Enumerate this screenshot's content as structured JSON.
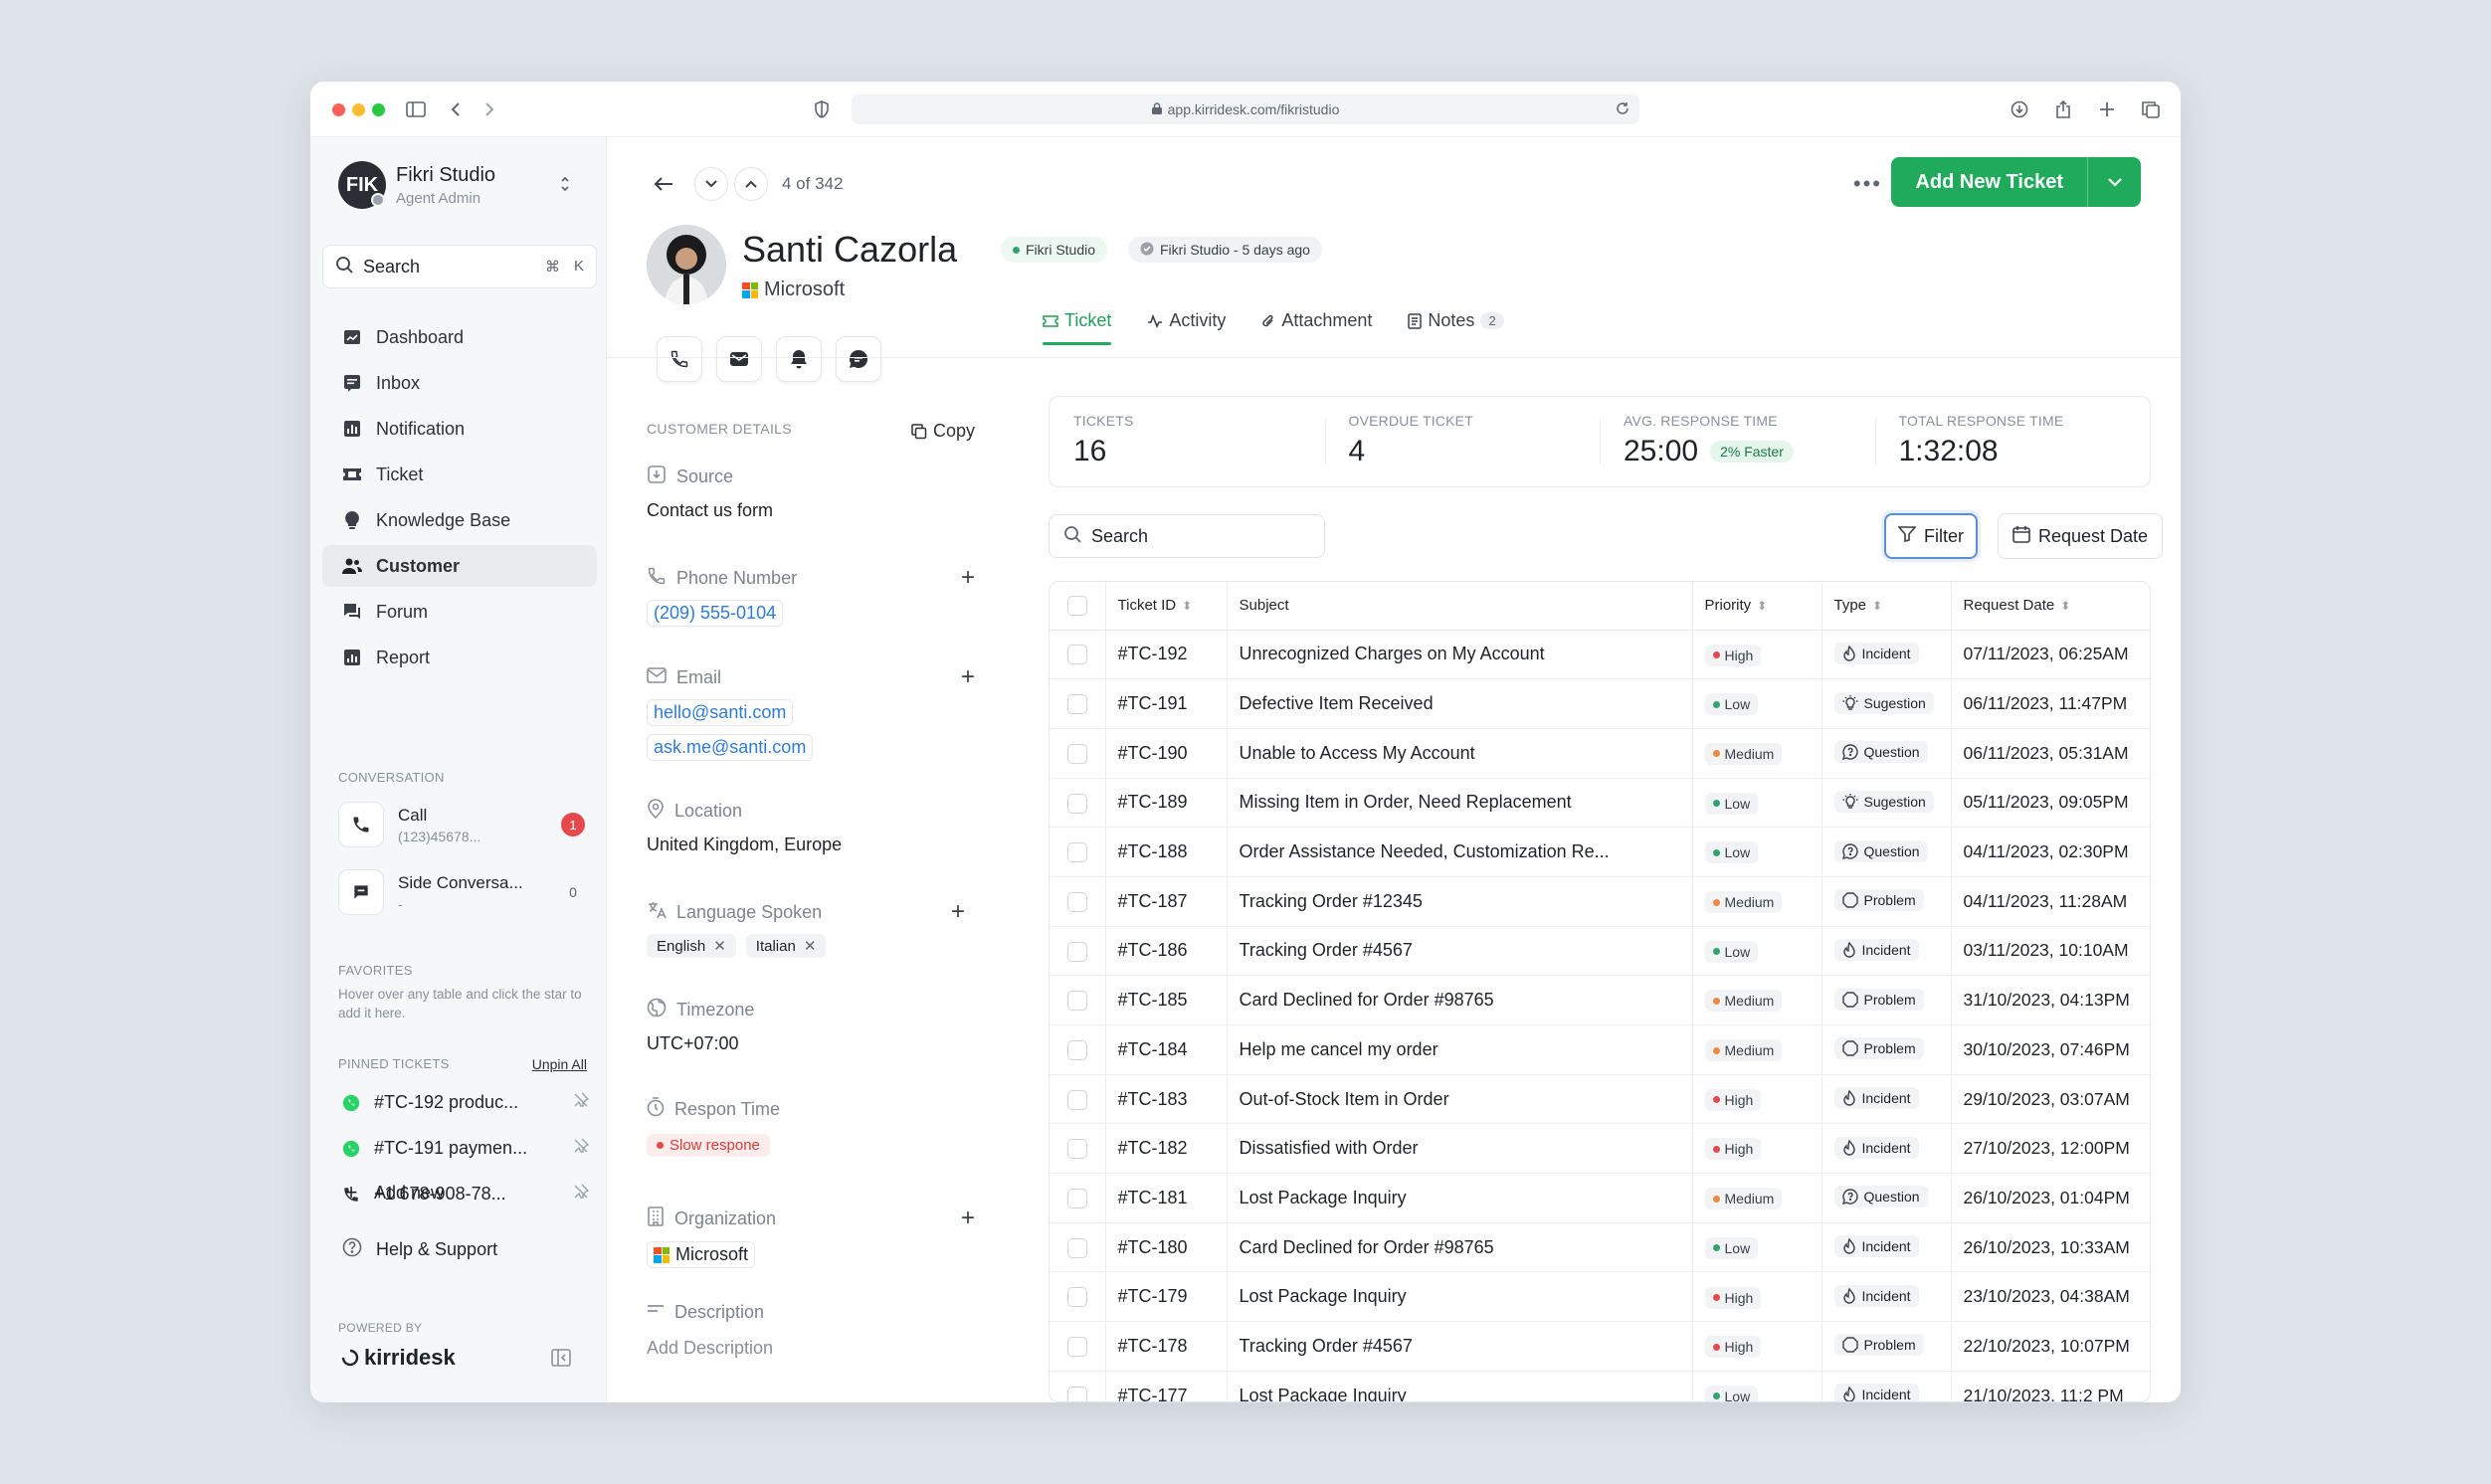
{
  "browser": {
    "url": "app.kirridesk.com/fikristudio"
  },
  "sidebar": {
    "org_initials": "FIK",
    "org_name": "Fikri Studio",
    "org_role": "Agent Admin",
    "search_label": "Search",
    "search_kbd_1": "⌘",
    "search_kbd_2": "K",
    "nav": [
      {
        "label": "Dashboard",
        "icon": "dashboard-icon"
      },
      {
        "label": "Inbox",
        "icon": "inbox-icon"
      },
      {
        "label": "Notification",
        "icon": "notification-icon"
      },
      {
        "label": "Ticket",
        "icon": "ticket-icon"
      },
      {
        "label": "Knowledge Base",
        "icon": "knowledge-icon"
      },
      {
        "label": "Customer",
        "icon": "customer-icon",
        "active": true
      },
      {
        "label": "Forum",
        "icon": "forum-icon"
      },
      {
        "label": "Report",
        "icon": "report-icon"
      }
    ],
    "conversation_title": "CONVERSATION",
    "conversations": [
      {
        "title": "Call",
        "sub": "(123)45678...",
        "count": "1"
      },
      {
        "title": "Side Conversa...",
        "sub": "-",
        "count": "0"
      }
    ],
    "favorites_title": "FAVORITES",
    "favorites_hint": "Hover over any table and click the star to add it here.",
    "pinned_title": "PINNED TICKETS",
    "unpin_all": "Unpin All",
    "pinned": [
      {
        "label": "#TC-192 produc...",
        "icon": "whatsapp-icon"
      },
      {
        "label": "#TC-191 paymen...",
        "icon": "whatsapp-icon"
      },
      {
        "label": "+1 678-908-78...",
        "icon": "phone-icon"
      }
    ],
    "add_new": "Add new",
    "help": "Help & Support",
    "powered_by": "POWERED BY",
    "brand": "kirridesk"
  },
  "header": {
    "pager": "4 of 342",
    "add_ticket": "Add New Ticket"
  },
  "customer": {
    "name": "Santi Cazorla",
    "status_chip": "Fikri Studio",
    "meta_chip": "Fikri Studio - 5 days ago",
    "company": "Microsoft"
  },
  "tabs": [
    {
      "label": "Ticket",
      "active": true
    },
    {
      "label": "Activity"
    },
    {
      "label": "Attachment"
    },
    {
      "label": "Notes",
      "count": "2"
    }
  ],
  "details": {
    "title": "CUSTOMER DETAILS",
    "copy": "Copy",
    "source_label": "Source",
    "source_value": "Contact us form",
    "phone_label": "Phone Number",
    "phone_value": "(209) 555-0104",
    "email_label": "Email",
    "emails": [
      "hello@santi.com",
      "ask.me@santi.com"
    ],
    "location_label": "Location",
    "location_value": "United Kingdom, Europe",
    "language_label": "Language Spoken",
    "languages": [
      "English",
      "Italian"
    ],
    "timezone_label": "Timezone",
    "timezone_value": "UTC+07:00",
    "response_label": "Respon Time",
    "response_value": "Slow respone",
    "organization_label": "Organization",
    "organization_value": "Microsoft",
    "description_label": "Description",
    "description_placeholder": "Add Description"
  },
  "stats": [
    {
      "label": "TICKETS",
      "value": "16"
    },
    {
      "label": "OVERDUE TICKET",
      "value": "4"
    },
    {
      "label": "AVG. RESPONSE TIME",
      "value": "25:00",
      "badge": "2% Faster"
    },
    {
      "label": "TOTAL RESPONSE TIME",
      "value": "1:32:08"
    }
  ],
  "table": {
    "search_placeholder": "Search",
    "filter": "Filter",
    "request_date": "Request Date",
    "columns": [
      "Ticket ID",
      "Subject",
      "Priority",
      "Type",
      "Request Date"
    ],
    "rows": [
      {
        "id": "#TC-192",
        "subject": "Unrecognized Charges on My Account",
        "priority": "High",
        "type": "Incident",
        "date": "07/11/2023, 06:25AM"
      },
      {
        "id": "#TC-191",
        "subject": "Defective Item Received",
        "priority": "Low",
        "type": "Sugestion",
        "date": "06/11/2023, 11:47PM"
      },
      {
        "id": "#TC-190",
        "subject": "Unable to Access My Account",
        "priority": "Medium",
        "type": "Question",
        "date": "06/11/2023, 05:31AM"
      },
      {
        "id": "#TC-189",
        "subject": "Missing Item in Order, Need Replacement",
        "priority": "Low",
        "type": "Sugestion",
        "date": "05/11/2023, 09:05PM"
      },
      {
        "id": "#TC-188",
        "subject": "Order Assistance Needed, Customization Re...",
        "priority": "Low",
        "type": "Question",
        "date": "04/11/2023, 02:30PM"
      },
      {
        "id": "#TC-187",
        "subject": "Tracking Order #12345",
        "priority": "Medium",
        "type": "Problem",
        "date": "04/11/2023, 11:28AM"
      },
      {
        "id": "#TC-186",
        "subject": "Tracking Order #4567",
        "priority": "Low",
        "type": "Incident",
        "date": "03/11/2023, 10:10AM"
      },
      {
        "id": "#TC-185",
        "subject": "Card Declined for Order #98765",
        "priority": "Medium",
        "type": "Problem",
        "date": "31/10/2023, 04:13PM"
      },
      {
        "id": "#TC-184",
        "subject": "Help me cancel my order",
        "priority": "Medium",
        "type": "Problem",
        "date": "30/10/2023, 07:46PM"
      },
      {
        "id": "#TC-183",
        "subject": "Out-of-Stock Item in Order",
        "priority": "High",
        "type": "Incident",
        "date": "29/10/2023, 03:07AM"
      },
      {
        "id": "#TC-182",
        "subject": "Dissatisfied with Order",
        "priority": "High",
        "type": "Incident",
        "date": "27/10/2023, 12:00PM"
      },
      {
        "id": "#TC-181",
        "subject": "Lost Package Inquiry",
        "priority": "Medium",
        "type": "Question",
        "date": "26/10/2023, 01:04PM"
      },
      {
        "id": "#TC-180",
        "subject": "Card Declined for Order #98765",
        "priority": "Low",
        "type": "Incident",
        "date": "26/10/2023, 10:33AM"
      },
      {
        "id": "#TC-179",
        "subject": "Lost Package Inquiry",
        "priority": "High",
        "type": "Incident",
        "date": "23/10/2023, 04:38AM"
      },
      {
        "id": "#TC-178",
        "subject": "Tracking Order #4567",
        "priority": "High",
        "type": "Problem",
        "date": "22/10/2023, 10:07PM"
      },
      {
        "id": "#TC-177",
        "subject": "Lost Package Inquiry",
        "priority": "Low",
        "type": "Incident",
        "date": "21/10/2023, 11:2 PM"
      }
    ]
  },
  "colors": {
    "accent": "#1faa5c",
    "high": "#e5484d",
    "medium": "#f0883e",
    "low": "#30a46c",
    "link": "#2f7bd6"
  }
}
